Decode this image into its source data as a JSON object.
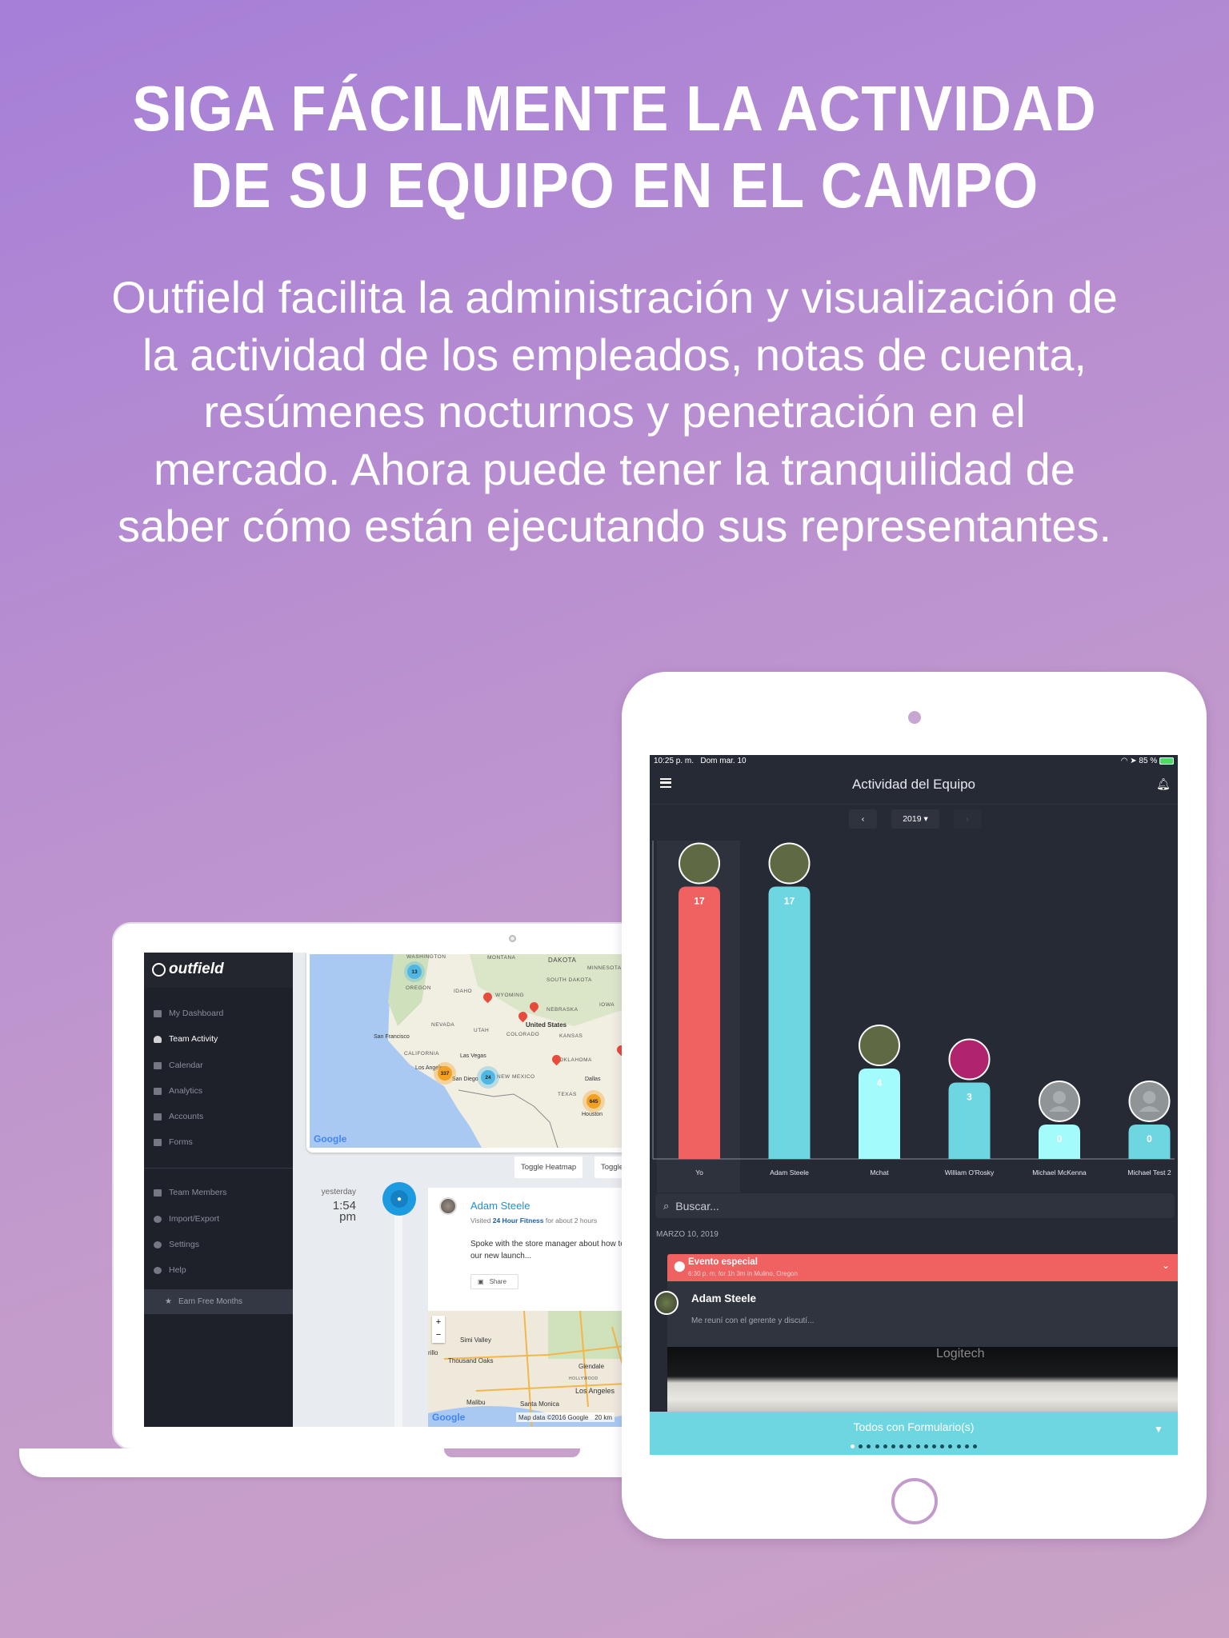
{
  "hero": {
    "title_lines": [
      "SIGA FÁCILMENTE LA ACTIVIDAD",
      "DE SU EQUIPO EN EL CAMPO"
    ],
    "text_lines": [
      "Outfield facilita la administración y visualización de",
      "la actividad de los empleados, notas de cuenta,",
      "resúmenes nocturnos y penetración en el",
      "mercado. Ahora puede tener la tranquilidad de",
      "saber cómo están ejecutando sus representantes."
    ]
  },
  "laptop": {
    "logo": "outfield",
    "sidebar": {
      "items": [
        {
          "label": "My Dashboard",
          "icon": "dashboard-icon",
          "active": false
        },
        {
          "label": "Team Activity",
          "icon": "speedometer-icon",
          "active": true
        },
        {
          "label": "Calendar",
          "icon": "calendar-icon",
          "active": false
        },
        {
          "label": "Analytics",
          "icon": "bar-chart-icon",
          "active": false
        },
        {
          "label": "Accounts",
          "icon": "briefcase-icon",
          "active": false
        },
        {
          "label": "Forms",
          "icon": "checkbox-icon",
          "active": false
        }
      ],
      "items2": [
        {
          "label": "Team Members",
          "icon": "flag-icon"
        },
        {
          "label": "Import/Export",
          "icon": "refresh-icon"
        },
        {
          "label": "Settings",
          "icon": "gear-icon"
        },
        {
          "label": "Help",
          "icon": "question-icon"
        }
      ],
      "earn": "Earn Free Months"
    },
    "map": {
      "labels": [
        "WASHINGTON",
        "MONTANA",
        "DAKOTA",
        "MINNESOTA",
        "OREGON",
        "IDAHO",
        "WYOMING",
        "SOUTH DAKOTA",
        "NEBRASKA",
        "IOWA",
        "NEVADA",
        "UTAH",
        "COLORADO",
        "KANSAS",
        "CALIFORNIA",
        "NEW MEXICO",
        "OKLAHOMA",
        "TEXAS"
      ],
      "cities": [
        "United States",
        "San Francisco",
        "Las Vegas",
        "Los Angeles",
        "San Diego",
        "Dallas",
        "Houston"
      ],
      "clusters": [
        "13",
        "337",
        "24",
        "645"
      ],
      "google": "Google"
    },
    "toggle_heatmap": "Toggle Heatmap",
    "toggle_other": "Toggle",
    "timeline": {
      "day": "yesterday",
      "time": "1:54",
      "ampm": "pm",
      "name": "Adam Steele",
      "visited_prefix": "Visited",
      "place": "24 Hour Fitness",
      "visited_suffix": "for about 2 hours",
      "note": "Spoke with the store manager about how to promote our new launch...",
      "share": "Share",
      "mini_map": {
        "places": [
          "Simi Valley",
          "Thousand Oaks",
          "Glendale",
          "Los Angeles",
          "Malibu",
          "Santa Monica",
          "HOLLYWOOD",
          "rillo"
        ],
        "attribution": "Map data ©2016 Google",
        "scale": "20 km",
        "zoom_in": "+",
        "zoom_out": "−",
        "google": "Google"
      }
    }
  },
  "ipad": {
    "status": {
      "time": "10:25 p. m.",
      "date": "Dom mar. 10",
      "battery": "85 %"
    },
    "title": "Actividad del Equipo",
    "year": "2019 ▾",
    "prev": "‹",
    "next": "›",
    "search_placeholder": "Buscar...",
    "date_header": "MARZO 10, 2019",
    "event": {
      "title": "Evento especial",
      "subtitle": "6:30 p. m. for 1h 3m in Mulino, Oregon"
    },
    "card": {
      "name": "Adam Steele",
      "note": "Me reuní con el gerente y discutí..."
    },
    "photo_text": "Logitech",
    "footer": {
      "label": "Todos con Formulario(s)",
      "pages": 16,
      "current_page": 1
    },
    "colors": {
      "accent": "#6dd6e1",
      "event": "#f06161",
      "background": "#262a35"
    }
  },
  "chart_data": {
    "type": "bar",
    "categories": [
      "Yo",
      "Adam Steele",
      "Mchat",
      "William  O'Rosky",
      "Michael McKenna",
      "Michael Test 2"
    ],
    "values": [
      17,
      17,
      4,
      3,
      0,
      0
    ],
    "colors": [
      "#f06161",
      "#6dd6e1",
      "#a3fbfb",
      "#6dd6e1",
      "#a3fbfb",
      "#6dd6e1"
    ],
    "avatars": [
      "photo",
      "photo",
      "photo",
      "flowers",
      "placeholder",
      "placeholder"
    ],
    "selected": "Yo",
    "title": "",
    "xlabel": "",
    "ylabel": ""
  }
}
